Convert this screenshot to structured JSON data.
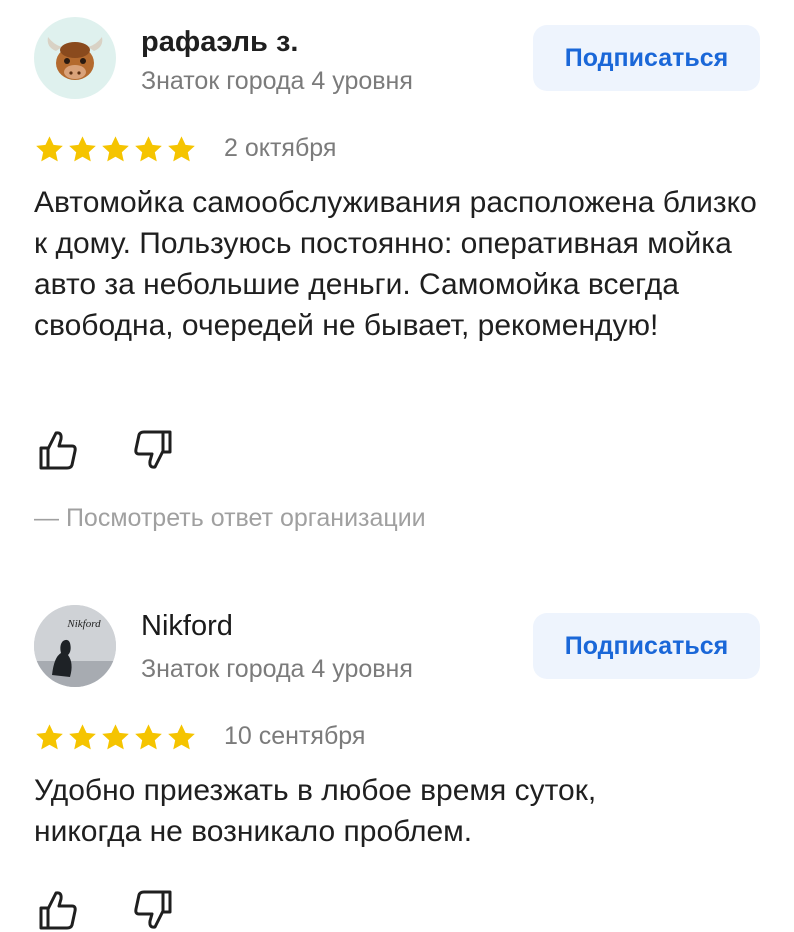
{
  "colors": {
    "star": "#f5c400",
    "accent": "#1a67d8",
    "button_bg": "#eef4fd",
    "muted": "#7b7b7b"
  },
  "reviews": [
    {
      "author": "рафаэль з.",
      "level": "Знаток города 4 уровня",
      "subscribe_label": "Подписаться",
      "avatar_icon": "yak-icon",
      "rating": 5,
      "date": "2 октября",
      "text": "Автомойка самообслуживания расположена близко к дому. Пользуюсь постоянно: оперативная мойка авто за небольшие деньги. Самомойка всегда свободна, очередей не бывает, рекомендую!",
      "answer_link": "— Посмотреть ответ организации"
    },
    {
      "author": "Nikford",
      "level": "Знаток города 4 уровня",
      "subscribe_label": "Подписаться",
      "avatar_icon": "user-photo-icon",
      "avatar_text": "Nikford",
      "rating": 5,
      "date": "10 сентября",
      "text": "Удобно приезжать в любое время суток, никогда не возникало проблем."
    }
  ]
}
